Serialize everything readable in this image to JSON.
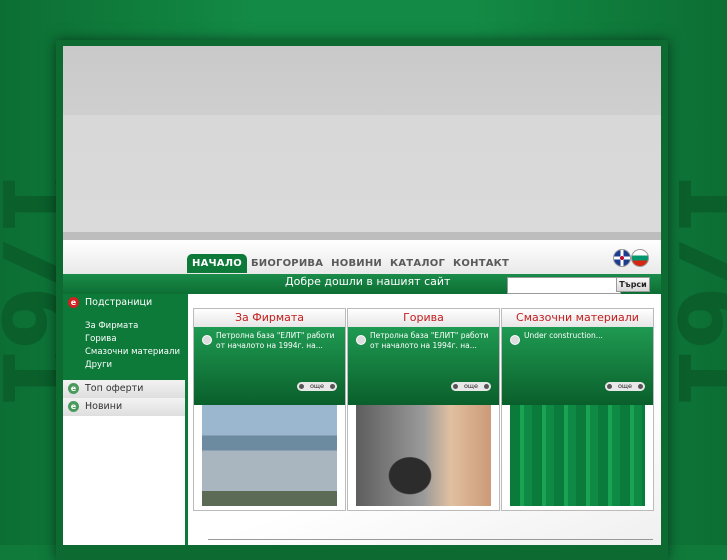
{
  "navigation": {
    "items": [
      {
        "label": "НАЧАЛО",
        "active": true
      },
      {
        "label": "БИОГОРИВА"
      },
      {
        "label": "НОВИНИ"
      },
      {
        "label": "КАТАЛОГ"
      },
      {
        "label": "КОНТАКТ"
      }
    ]
  },
  "welcome": "Добре дошли в нашият сайт",
  "search": {
    "button_label": "Търси",
    "value": ""
  },
  "sidebar": {
    "main_heading": "Подстраници",
    "subitems": [
      "За Фирмата",
      "Горива",
      "Смазочни материали",
      "Други"
    ],
    "top_offers": "Топ оферти",
    "news": "Новини"
  },
  "boxes": [
    {
      "title": "За Фирмата",
      "text": "Петролна база \"ЕЛИТ\" работи от началото на 1994г. на...",
      "more": "още"
    },
    {
      "title": "Горива",
      "text": "Петролна база \"ЕЛИТ\" работи от началото на 1994г. на...",
      "more": "още"
    },
    {
      "title": "Смазочни материали",
      "text": "Under construction...",
      "more": "още"
    }
  ],
  "colors": {
    "brand_green": "#0d7a3a",
    "title_red": "#c31d1d"
  },
  "watermark": "1761"
}
